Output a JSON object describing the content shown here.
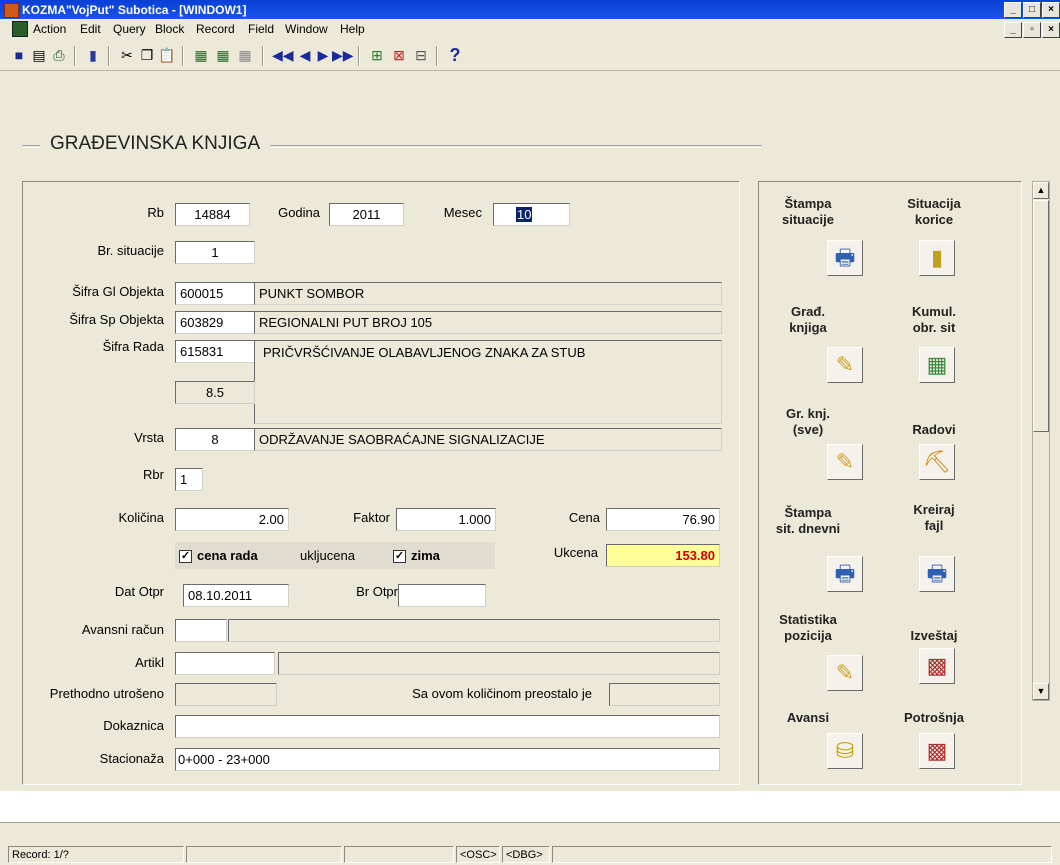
{
  "window": {
    "title": "KOZMA\"VojPut\" Subotica - [WINDOW1]"
  },
  "menu": [
    "Action",
    "Edit",
    "Query",
    "Block",
    "Record",
    "Field",
    "Window",
    "Help"
  ],
  "toolbar": {
    "help_glyph": "?"
  },
  "form": {
    "title": "GRAĐEVINSKA KNJIGA",
    "rb_label": "Rb",
    "rb": "14884",
    "godina_label": "Godina",
    "godina": "2011",
    "mesec_label": "Mesec",
    "mesec": "10",
    "br_situacije_label": "Br. situacije",
    "br_situacije": "1",
    "sifra_gl_label": "Šifra Gl Objekta",
    "sifra_gl": "600015",
    "sifra_gl_naziv": "PUNKT SOMBOR",
    "sifra_sp_label": "Šifra Sp Objekta",
    "sifra_sp": "603829",
    "sifra_sp_naziv": "REGIONALNI PUT BROJ 105",
    "sifra_rada_label": "Šifra Rada",
    "sifra_rada": "615831",
    "sifra_rada_naziv": "PRIČVRŠĆIVANJE OLABAVLJENOG ZNAKA ZA STUB",
    "sub_value": "8.5",
    "vrsta_label": "Vrsta",
    "vrsta": "8",
    "vrsta_naziv": "ODRŽAVANJE SAOBRAĆAJNE SIGNALIZACIJE",
    "rbr_label": "Rbr",
    "rbr": "1",
    "kolicina_label": "Količina",
    "kolicina": "2.00",
    "faktor_label": "Faktor",
    "faktor": "1.000",
    "cena_label": "Cena",
    "cena": "76.90",
    "cena_rada_label": "cena rada",
    "ukljucena_label": "ukljucena",
    "zima_label": "zima",
    "ukcena_label": "Ukcena",
    "ukcena": "153.80",
    "dat_otpr_label": "Dat Otpr",
    "dat_otpr": "08.10.2011",
    "br_otpr_label": "Br Otpr",
    "br_otpr": "",
    "avansni_label": "Avansni račun",
    "artikl_label": "Artikl",
    "prethodno_label": "Prethodno utrošeno",
    "preostalo_label": "Sa ovom količinom preostalo je",
    "dokaznica_label": "Dokaznica",
    "dokaznica": "",
    "stacionaza_label": "Stacionaža",
    "stacionaza": "0+000 - 23+000"
  },
  "panel": [
    {
      "l1": "Štampa",
      "l2": "situacije",
      "icon": "printer-icon"
    },
    {
      "l1": "Situacija",
      "l2": "korice",
      "icon": "folder-icon"
    },
    {
      "l1": "Građ.",
      "l2": "knjiga",
      "icon": "notepad-icon"
    },
    {
      "l1": "Kumul.",
      "l2": "obr. sit",
      "icon": "calculator-icon"
    },
    {
      "l1": "Gr. knj.",
      "l2": "(sve)",
      "icon": "notepad-icon"
    },
    {
      "l1": "Radovi",
      "l2": "",
      "icon": "excavator-icon"
    },
    {
      "l1": "Štampa",
      "l2": "sit. dnevni",
      "icon": "printer-icon"
    },
    {
      "l1": "Kreiraj",
      "l2": "fajl",
      "icon": "printer-icon"
    },
    {
      "l1": "Statistika",
      "l2": "pozicija",
      "icon": "notepad-icon"
    },
    {
      "l1": "Izveštaj",
      "l2": "",
      "icon": "report-icon"
    },
    {
      "l1": "Avansi",
      "l2": "",
      "icon": "coins-icon"
    },
    {
      "l1": "Potrošnja",
      "l2": "",
      "icon": "report-icon"
    }
  ],
  "status": {
    "record": "Record: 1/?",
    "osc": "<OSC>",
    "dbg": "<DBG>"
  }
}
